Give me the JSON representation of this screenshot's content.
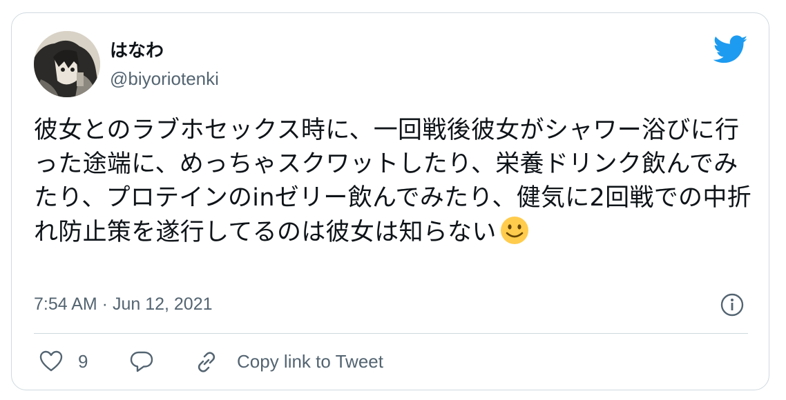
{
  "tweet": {
    "author_name": "はなわ",
    "author_handle": "@biyoriotenki",
    "text": "彼女とのラブホセックス時に、一回戦後彼女がシャワー浴びに行った途端に、めっちゃスクワットしたり、栄養ドリンク飲んでみたり、プロテインのinゼリー飲んでみたり、健気に2回戦での中折れ防止策を遂行してるのは彼女は知らない",
    "emoji": "slightly-smiling-face",
    "timestamp": "7:54 AM · Jun 12, 2021",
    "like_count": "9",
    "copy_link_label": "Copy link to Tweet"
  },
  "colors": {
    "brand": "#1d9bf0",
    "text": "#0f1419",
    "secondary": "#536471",
    "border": "#cfd9de"
  },
  "icons": [
    "avatar",
    "twitter-bird-icon",
    "info-icon",
    "heart-icon",
    "reply-icon",
    "link-icon",
    "smile-emoji-icon"
  ]
}
